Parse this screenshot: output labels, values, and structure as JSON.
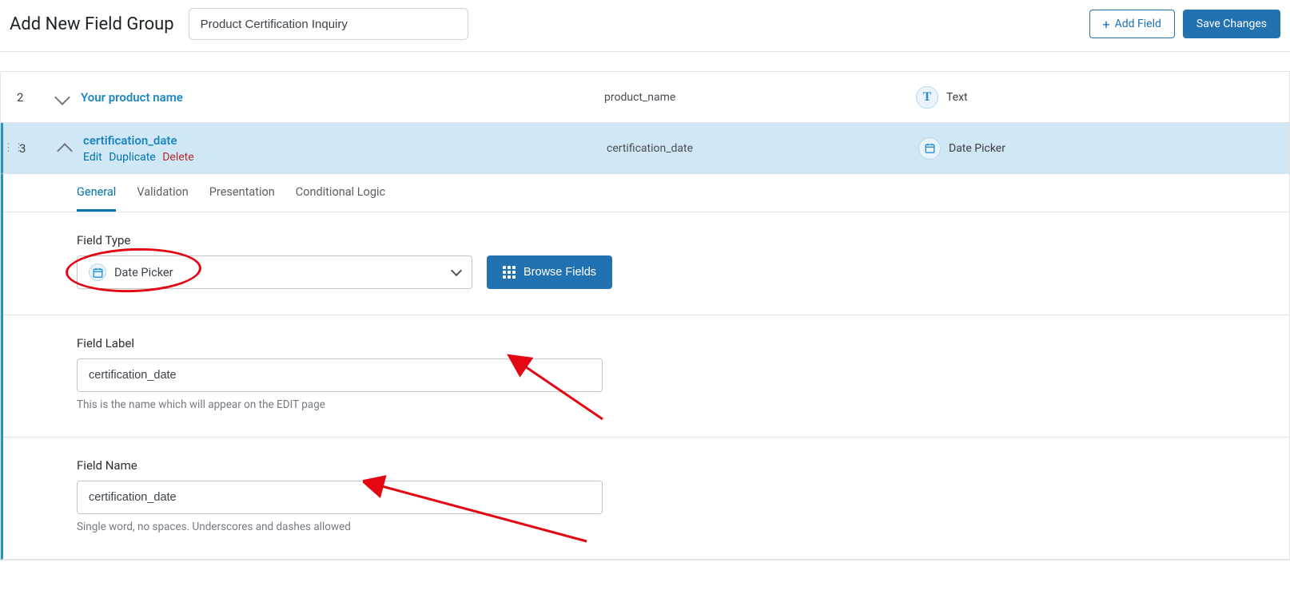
{
  "header": {
    "page_title": "Add New Field Group",
    "group_name": "Product Certification Inquiry",
    "add_field_label": "Add Field",
    "save_label": "Save Changes"
  },
  "rows": {
    "r2": {
      "num": "2",
      "label": "Your product name",
      "name": "product_name",
      "type": "Text"
    },
    "r3": {
      "num": "3",
      "label": "certification_date",
      "name": "certification_date",
      "type": "Date Picker",
      "actions": {
        "edit": "Edit",
        "duplicate": "Duplicate",
        "delete": "Delete"
      }
    }
  },
  "tabs": {
    "general": "General",
    "validation": "Validation",
    "presentation": "Presentation",
    "conditional": "Conditional Logic"
  },
  "settings": {
    "field_type": {
      "label": "Field Type",
      "value": "Date Picker",
      "browse": "Browse Fields"
    },
    "field_label": {
      "label": "Field Label",
      "value": "certification_date",
      "hint": "This is the name which will appear on the EDIT page"
    },
    "field_name": {
      "label": "Field Name",
      "value": "certification_date",
      "hint": "Single word, no spaces. Underscores and dashes allowed"
    }
  }
}
